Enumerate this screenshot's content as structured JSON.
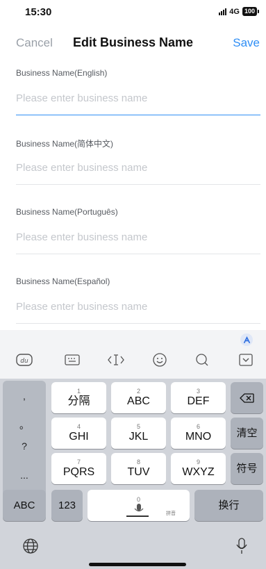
{
  "status_bar": {
    "time": "15:30",
    "network": "4G",
    "battery": "100"
  },
  "nav": {
    "cancel_label": "Cancel",
    "title": "Edit Business Name",
    "save_label": "Save"
  },
  "form": {
    "fields": [
      {
        "label": "Business Name(English)",
        "placeholder": "Please enter business name",
        "value": "",
        "focused": true
      },
      {
        "label": "Business Name(简体中文)",
        "placeholder": "Please enter business name",
        "value": ""
      },
      {
        "label": "Business Name(Português)",
        "placeholder": "Please enter business name",
        "value": ""
      },
      {
        "label": "Business Name(Español)",
        "placeholder": "Please enter business name",
        "value": ""
      }
    ]
  },
  "keyboard": {
    "toolbar_icons": [
      "baidu-icon",
      "keyboard-icon",
      "cursor-icon",
      "emoji-icon",
      "search-icon",
      "collapse-keyboard-icon"
    ],
    "side_column": [
      ",",
      "。",
      "?",
      "..."
    ],
    "keys": {
      "k1": {
        "num": "1",
        "label": "分隔"
      },
      "k2": {
        "num": "2",
        "label": "ABC"
      },
      "k3": {
        "num": "3",
        "label": "DEF"
      },
      "k4": {
        "num": "4",
        "label": "GHI"
      },
      "k5": {
        "num": "5",
        "label": "JKL"
      },
      "k6": {
        "num": "6",
        "label": "MNO"
      },
      "k7": {
        "num": "7",
        "label": "PQRS"
      },
      "k8": {
        "num": "8",
        "label": "TUV"
      },
      "k9": {
        "num": "9",
        "label": "WXYZ"
      },
      "k0": {
        "num": "0",
        "label": ""
      }
    },
    "clear_label": "清空",
    "symbol_label": "符号",
    "abc_label": "ABC",
    "num_label": "123",
    "space_hint": "拼音",
    "enter_label": "换行"
  },
  "colors": {
    "accent": "#2f8ef5",
    "muted_text": "#9aa0a8",
    "placeholder": "#c4c7cc",
    "keyboard_bg": "#d1d4da"
  }
}
